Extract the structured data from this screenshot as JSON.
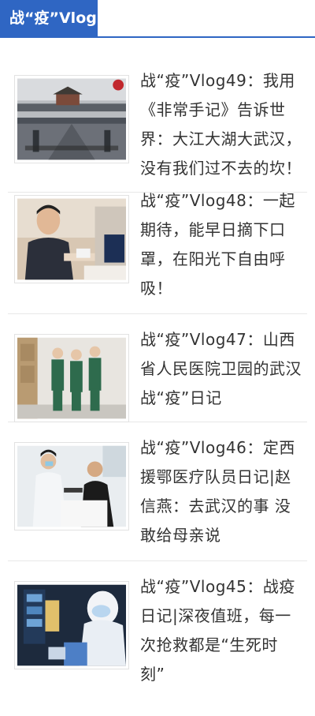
{
  "header": {
    "tab_label": "战“疫”Vlog"
  },
  "articles": [
    {
      "title": "战“疫”Vlog49：我用《非常手记》告诉世界：大江大湖大武汉，没有我们过不去的坎！",
      "thumb": "highway-gate-photo"
    },
    {
      "title": "战“疫”Vlog48：一起期待，能早日摘下口罩，在阳光下自由呼吸！",
      "thumb": "man-at-computer-photo"
    },
    {
      "title": "战“疫”Vlog47：山西省人民医院卫园的武汉战“疫”日记",
      "thumb": "medical-staff-photo"
    },
    {
      "title": "战“疫”Vlog46：定西援鄂医疗队员日记|赵信燕：去武汉的事 没敢给母亲说",
      "thumb": "doctor-patient-photo"
    },
    {
      "title": "战“疫”Vlog45：战疫日记|深夜值班，每一次抢救都是“生死时刻”",
      "thumb": "protective-suit-photo"
    }
  ]
}
